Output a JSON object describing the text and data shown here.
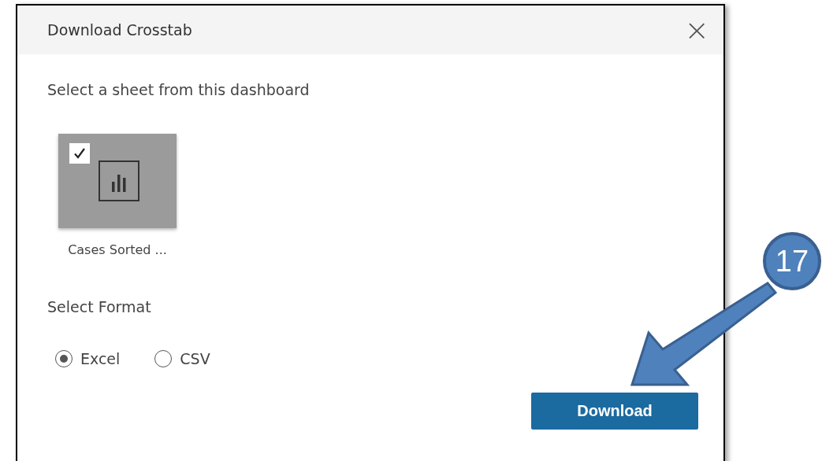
{
  "dialog": {
    "title": "Download Crosstab",
    "close": "×"
  },
  "sheet_prompt": "Select a sheet from this dashboard",
  "sheets": [
    {
      "label": "Cases Sorted ...",
      "selected": true
    }
  ],
  "format_prompt": "Select Format",
  "formats": [
    {
      "label": "Excel",
      "selected": true
    },
    {
      "label": "CSV",
      "selected": false
    }
  ],
  "download_button": "Download",
  "annotation": {
    "badge": "17"
  }
}
